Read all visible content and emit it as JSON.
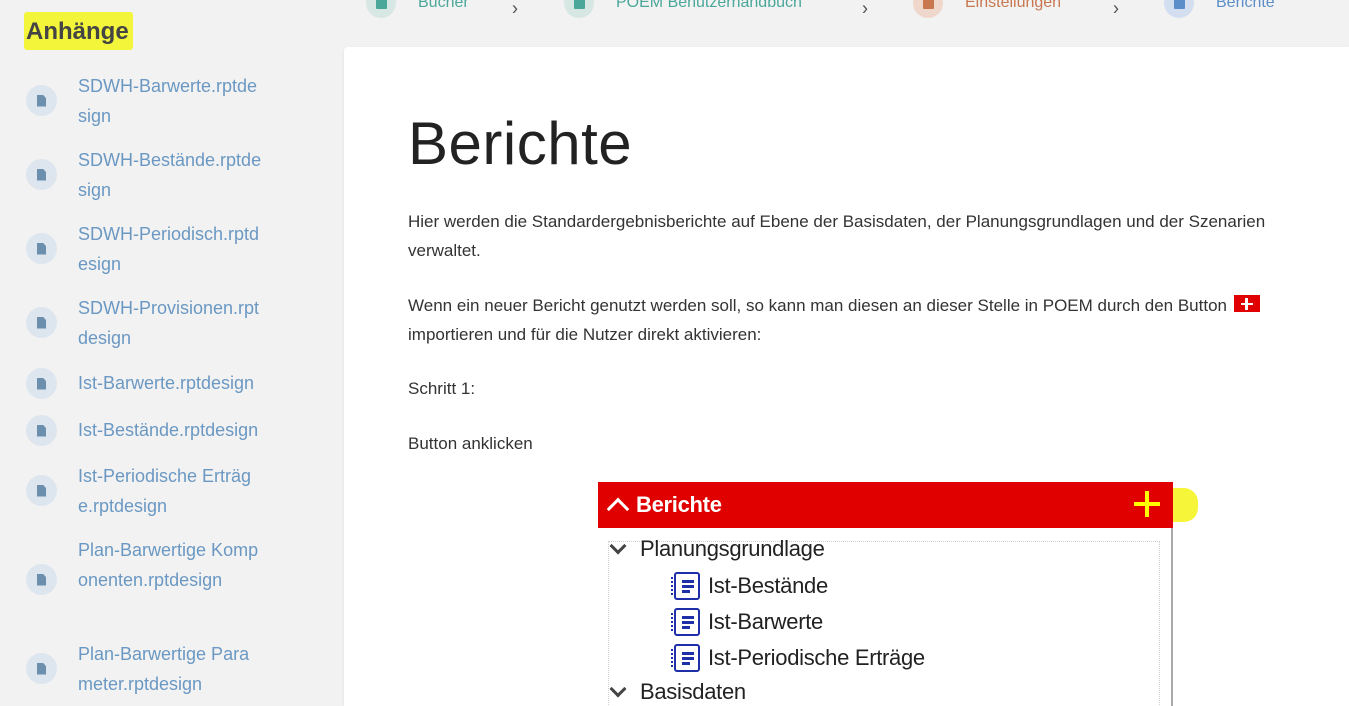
{
  "breadcrumb": {
    "items": [
      {
        "label": "Bücher",
        "icon": "books-icon"
      },
      {
        "label": "POEM Benutzerhandbuch",
        "icon": "book-icon"
      },
      {
        "label": "Einstellungen",
        "icon": "chapter-icon"
      },
      {
        "label": "Berichte",
        "icon": "page-icon"
      }
    ],
    "separator": "›"
  },
  "sidebar": {
    "title": "Anhänge",
    "attachments": [
      "SDWH-Barwerte.rptdesign",
      "SDWH-Bestände.rptdesign",
      "SDWH-Periodisch.rptdesign",
      "SDWH-Provisionen.rptdesign",
      "Ist-Barwerte.rptdesign",
      "Ist-Bestände.rptdesign",
      "Ist-Periodische Erträge.rptdesign",
      "Plan-Barwertige Komponenten.rptdesign",
      "Plan-Barwertige Parameter.rptdesign"
    ]
  },
  "page": {
    "title": "Berichte",
    "intro": "Hier werden die Standardergebnisberichte auf Ebene der Basisdaten, der Planungsgrundlagen und der Szenarien verwaltet.",
    "import_text_before": "Wenn ein neuer Bericht genutzt werden soll, so kann man diesen an dieser Stelle in POEM durch den Button",
    "import_text_after": "importieren und für die Nutzer direkt aktivieren:",
    "step_label": "Schritt 1:",
    "step_text": "Button anklicken"
  },
  "screenshot": {
    "header_title": "Berichte",
    "tree": [
      {
        "label": "Planungsgrundlage",
        "type": "group"
      },
      {
        "label": "Ist-Bestände",
        "type": "report"
      },
      {
        "label": "Ist-Barwerte",
        "type": "report"
      },
      {
        "label": "Ist-Periodische Erträge",
        "type": "report"
      },
      {
        "label": "Basisdaten",
        "type": "group"
      }
    ]
  },
  "colors": {
    "accent_teal": "#4aa79a",
    "accent_orange": "#c9774f",
    "accent_blue": "#5c8ec9",
    "link": "#6a98c3",
    "header_red": "#e00000",
    "highlight_yellow": "#f2f53a"
  }
}
